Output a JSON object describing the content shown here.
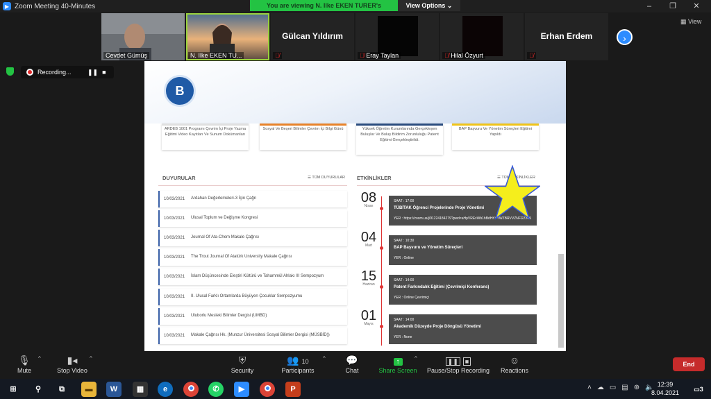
{
  "window": {
    "title": "Zoom Meeting 40-Minutes",
    "controls": [
      "–",
      "❐",
      "✕"
    ]
  },
  "banner": {
    "viewing": "You are viewing N. Ilke EKEN TURER's screen",
    "options": "View Options ⌄"
  },
  "participants": [
    {
      "name": "Cevdet Gümüş",
      "muted": false
    },
    {
      "name": "N. Ilke EKEN TU...",
      "muted": false
    },
    {
      "name": "Gülcan Yıldırım",
      "muted": true
    },
    {
      "name": "Eray Taylan",
      "muted": true
    },
    {
      "name": "Hilal Özyurt",
      "muted": true
    },
    {
      "name": "Erhan Erdem",
      "muted": true
    }
  ],
  "view_label": "View",
  "recording": {
    "label": "Recording...",
    "pause": "❚❚",
    "stop": "■"
  },
  "site": {
    "cards": [
      {
        "text": "ARDEB 1001 Programı Çevrim İçi Proje Yazma Eğitimi Video Kayıtları Ve Sunum Dokümanları",
        "color": "#e0e0e0"
      },
      {
        "text": "Sosyal Ve Beşeri Bilimler Çevrim İçi Bilgi Günü",
        "color": "#e8822a"
      },
      {
        "text": "Yüksek Öğretim Kurumlarında Gerçekleşen Buluşlar Ve Buluş Bildirim Zorunluluğu Patent Eğitimi Gerçekleştirildi.",
        "color": "#2b4c7e"
      },
      {
        "text": "BAP Başvuru Ve Yönetim Süreçleri Eğitimi Yapıldı",
        "color": "#f0c419"
      }
    ],
    "announcements_title": "DUYURULAR",
    "announcements_link": "☰ TÜM DUYURULAR",
    "events_title": "ETKİNLİKLER",
    "events_link": "☰ TÜM ETKİNLİKLER",
    "announcements": [
      {
        "date": "10/03/2021",
        "title": "Ardahan Değerlemeleri-3 İçin Çağrı"
      },
      {
        "date": "10/03/2021",
        "title": "Ulusal Toplum ve Değişme Kongresi"
      },
      {
        "date": "10/03/2021",
        "title": "Journal Of Ata-Chem Makale Çağrısı"
      },
      {
        "date": "10/03/2021",
        "title": "The Trout Journal Of Atatürk University Makale Çağrısı"
      },
      {
        "date": "10/03/2021",
        "title": "İslam Düşüncesinde Eleştiri Kültürü ve Tahammül Ahlakı III Sempozyum"
      },
      {
        "date": "10/03/2021",
        "title": "II. Ulusal Farklı Ortamlarda Büyüyen Çocuklar Sempozyumu"
      },
      {
        "date": "10/03/2021",
        "title": "Uluborlu Mesleki Bilimler Dergisi (UMBD)"
      },
      {
        "date": "10/03/2021",
        "title": "Makale Çağrısı Hk. (Munzur Üniversitesi Sosyal Bilimler Dergisi (MÜSBİD))"
      }
    ],
    "events": [
      {
        "day": "08",
        "month": "Nisan",
        "time": "SAAT : 17:00",
        "title": "TÜBİTAK Öğrenci Projelerinde Proje Yönetimi",
        "place": "YER : https://zoom.us/j/91224184279?pwd=aHpVRExWb1hBdHhYYWZBRVVZNFl2Zz09"
      },
      {
        "day": "04",
        "month": "Mart",
        "time": "SAAT : 10:30",
        "title": "BAP Başvuru ve Yönetim Süreçleri",
        "place": "YER : Online"
      },
      {
        "day": "15",
        "month": "Haziran",
        "time": "SAAT : 14:00",
        "title": "Patent Farkındalık Eğitimi (Çevrimiçi Konferans)",
        "place": "YER : Online Çevrimiçi"
      },
      {
        "day": "01",
        "month": "Mayıs",
        "time": "SAAT : 14:00",
        "title": "Akademik Düzeyde Proje Döngüsü Yönetimi",
        "place": "YER : None"
      }
    ]
  },
  "toolbar": {
    "mute": "Mute",
    "stop_video": "Stop Video",
    "security": "Security",
    "participants": "Participants",
    "participants_count": "10",
    "chat": "Chat",
    "share_screen": "Share Screen",
    "pause_recording": "Pause/Stop Recording",
    "reactions": "Reactions",
    "end": "End"
  },
  "taskbar": {
    "time": "12:39",
    "date": "8.04.2021",
    "notifications": "3"
  },
  "colors": {
    "zoom_blue": "#2d8cff",
    "green": "#23c343",
    "end_red": "#c62b2b",
    "timeline_red": "#dd3333"
  }
}
